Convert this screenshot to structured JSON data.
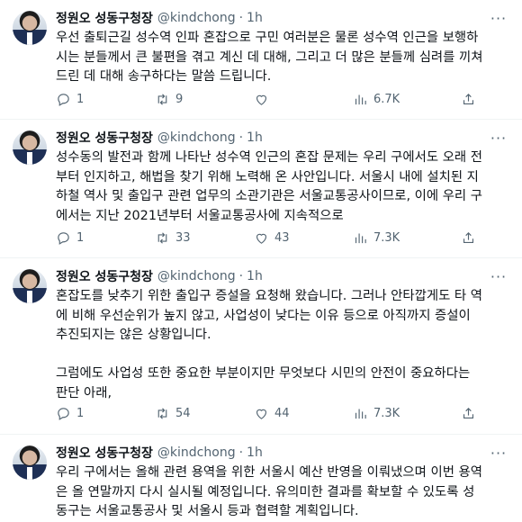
{
  "tweets": [
    {
      "name": "정원오 성동구청장",
      "handle": "@kindchong",
      "time": "1h",
      "text": "우선 출퇴근길 성수역 인파 혼잡으로 구민 여러분은 물론 성수역 인근을 보행하\n시는 분들께서 큰 불편을 겪고 계신 데 대해, 그리고 더 많은 분들께 심려를 끼쳐\n드린 데 대해 송구하다는 말씀 드립니다.",
      "replies": "1",
      "retweets": "9",
      "likes": "",
      "views": "6.7K"
    },
    {
      "name": "정원오 성동구청장",
      "handle": "@kindchong",
      "time": "1h",
      "text": "성수동의 발전과 함께 나타난 성수역 인근의 혼잡 문제는 우리 구에서도 오래 전\n부터 인지하고, 해법을 찾기 위해 노력해 온 사안입니다. 서울시 내에 설치된 지\n하철 역사 및 출입구 관련 업무의 소관기관은 서울교통공사이므로, 이에 우리 구\n에서는 지난 2021년부터 서울교통공사에 지속적으로",
      "replies": "1",
      "retweets": "33",
      "likes": "43",
      "views": "7.3K"
    },
    {
      "name": "정원오 성동구청장",
      "handle": "@kindchong",
      "time": "1h",
      "text": "혼잡도를 낮추기 위한 출입구 증설을 요청해 왔습니다. 그러나 안타깝게도 타 역\n에 비해 우선순위가 높지 않고, 사업성이 낮다는 이유 등으로 아직까지 증설이\n추진되지는 않은 상황입니다.\n\n그럼에도 사업성 또한 중요한 부분이지만 무엇보다 시민의 안전이 중요하다는\n판단 아래,",
      "replies": "1",
      "retweets": "54",
      "likes": "44",
      "views": "7.3K"
    },
    {
      "name": "정원오 성동구청장",
      "handle": "@kindchong",
      "time": "1h",
      "text": "우리 구에서는 올해 관련 용역을 위한 서울시 예산 반영을 이뤄냈으며 이번 용역\n은 올 연말까지 다시 실시될 예정입니다. 유의미한 결과를 확보할 수 있도록 성\n동구는 서울교통공사 및 서울시 등과 협력할 계획입니다.",
      "replies": "",
      "retweets": "",
      "likes": "",
      "views": ""
    }
  ],
  "icons": {
    "more": "more-horizontal-icon",
    "reply": "reply-icon",
    "retweet": "retweet-icon",
    "like": "heart-icon",
    "views": "views-icon",
    "share": "share-icon"
  },
  "colors": {
    "text": "#0f1419",
    "muted": "#536471",
    "divider": "#eff3f4"
  }
}
